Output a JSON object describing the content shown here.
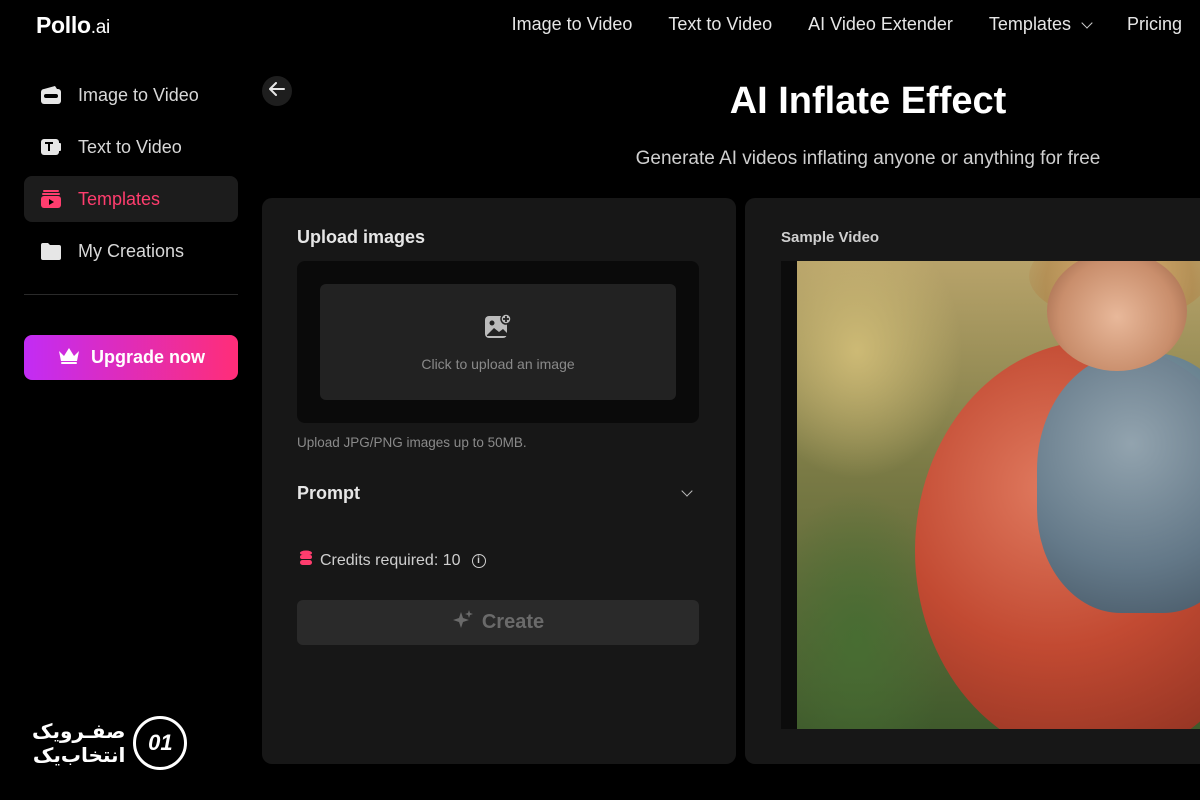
{
  "brand": {
    "name": "Pollo",
    "suffix": ".ai"
  },
  "topnav": {
    "items": [
      "Image to Video",
      "Text to Video",
      "AI Video Extender",
      "Templates",
      "Pricing"
    ]
  },
  "sidebar": {
    "items": [
      {
        "label": "Image to Video",
        "icon": "wallet-icon"
      },
      {
        "label": "Text to Video",
        "icon": "text-to-video-icon"
      },
      {
        "label": "Templates",
        "icon": "templates-icon",
        "active": true
      },
      {
        "label": "My Creations",
        "icon": "folder-icon"
      }
    ],
    "upgrade_label": "Upgrade now"
  },
  "header": {
    "title": "AI Inflate Effect",
    "subtitle": "Generate AI videos inflating anyone or anything for free"
  },
  "upload": {
    "title": "Upload images",
    "dropzone_text": "Click to upload an image",
    "hint": "Upload JPG/PNG images up to 50MB."
  },
  "prompt": {
    "title": "Prompt"
  },
  "credits": {
    "label": "Credits required: 10"
  },
  "create": {
    "label": "Create"
  },
  "sample": {
    "title": "Sample Video"
  },
  "watermark": {
    "line1": "صفـرویک",
    "line2": "انتخاب‌یک",
    "logo_text": "01"
  },
  "colors": {
    "accent": "#ff3d6e",
    "gradient_start": "#c22cf5",
    "gradient_end": "#ff2d78",
    "panel": "#171717"
  }
}
